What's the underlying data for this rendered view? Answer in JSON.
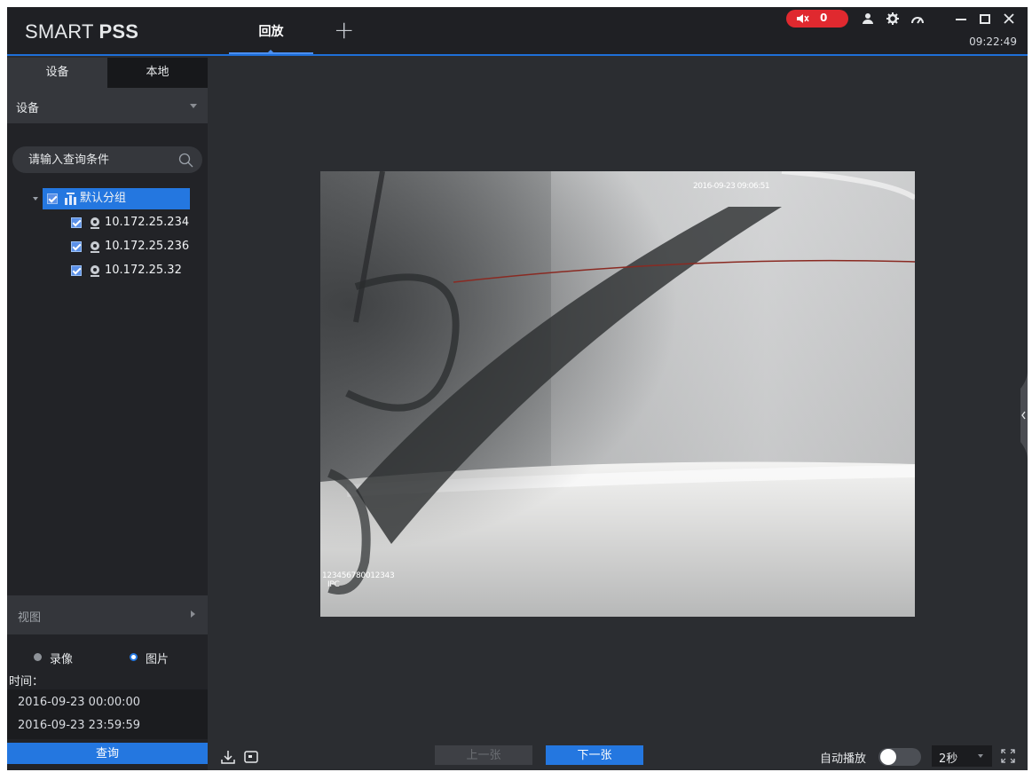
{
  "app": {
    "logo_light": "SMART ",
    "logo_bold": "PSS",
    "tab_label": "回放",
    "add_tab_symbol": "+",
    "alarm_count": "0",
    "clock": "09:22:49",
    "accent_color": "#2477e0",
    "alarm_color": "#e0292f"
  },
  "window_controls": {
    "icons": [
      "minimize-icon",
      "maximize-icon",
      "close-icon"
    ]
  },
  "toolbar_icons": [
    "mute-icon",
    "user-icon",
    "settings-icon",
    "performance-icon"
  ],
  "sidebar": {
    "tabs": [
      {
        "label": "设备",
        "active": true
      },
      {
        "label": "本地",
        "active": false
      }
    ],
    "device_select": "设备",
    "search_placeholder": "请输入查询条件",
    "tree": {
      "root": {
        "label": "默认分组",
        "checked": true,
        "selected": true
      },
      "devices": [
        {
          "label": "10.172.25.234",
          "checked": true
        },
        {
          "label": "10.172.25.236",
          "checked": true
        },
        {
          "label": "10.172.25.32",
          "checked": true
        }
      ]
    },
    "view_header": "视图",
    "mode_options": [
      {
        "label": "录像",
        "selected": false
      },
      {
        "label": "图片",
        "selected": true
      }
    ],
    "time_label": "时间：",
    "time_start": "2016-09-23 00:00:00",
    "time_end": "2016-09-23 23:59:59",
    "query_button": "查询"
  },
  "viewer": {
    "osd_timestamp": "2016-09-23 09:06:51",
    "osd_device_id": "123456780012343",
    "osd_device_type": "IPC"
  },
  "bottom_bar": {
    "prev_button": "上一张",
    "next_button": "下一张",
    "autoplay_label": "自动播放",
    "autoplay_on": false,
    "interval_value": "2秒"
  }
}
